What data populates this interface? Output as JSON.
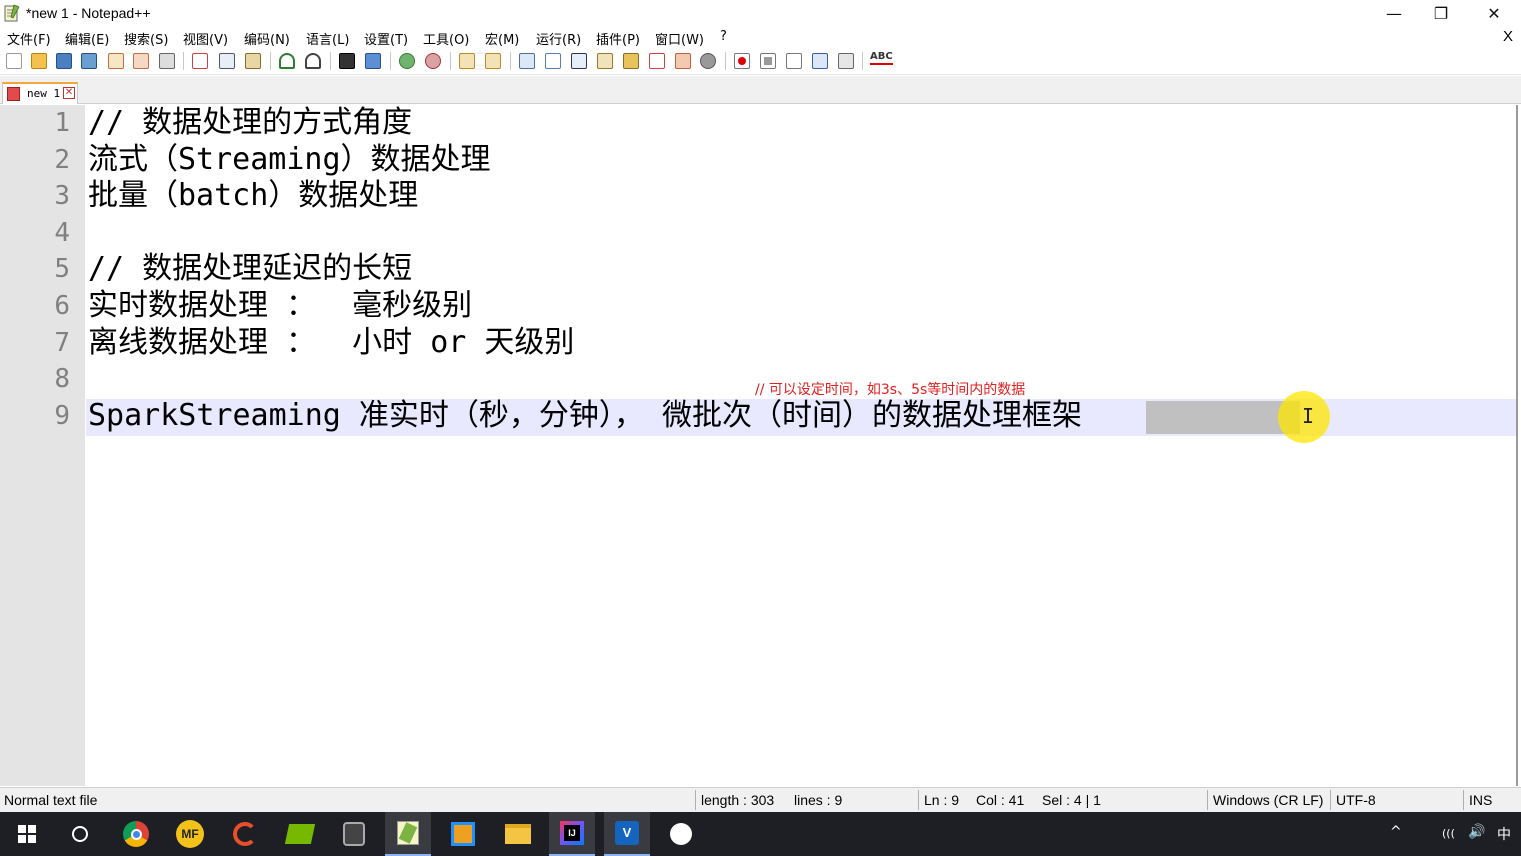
{
  "window": {
    "title": "*new 1 - Notepad++",
    "controls": {
      "minimize": "—",
      "maximize": "❐",
      "close": "✕"
    }
  },
  "menubar": {
    "items": [
      "文件(F)",
      "编辑(E)",
      "搜索(S)",
      "视图(V)",
      "编码(N)",
      "语言(L)",
      "设置(T)",
      "工具(O)",
      "宏(M)",
      "运行(R)",
      "插件(P)",
      "窗口(W)",
      "?"
    ],
    "close_doc": "X"
  },
  "toolbar": {
    "spellcheck_label": "ABC",
    "icons": [
      "new-file-icon",
      "open-file-icon",
      "save-icon",
      "save-all-icon",
      "close-icon",
      "close-all-icon",
      "print-icon",
      "cut-icon",
      "copy-icon",
      "paste-icon",
      "undo-icon",
      "redo-icon",
      "find-icon",
      "replace-icon",
      "zoom-in-icon",
      "zoom-out-icon",
      "sync-vertical-icon",
      "sync-horizontal-icon",
      "word-wrap-icon",
      "show-all-chars-icon",
      "indent-guide-icon",
      "doc-map-icon",
      "function-list-icon",
      "folder-workspace-icon",
      "monitoring-icon",
      "record-macro-icon",
      "stop-record-icon",
      "play-macro-icon",
      "run-macro-multiple-icon",
      "save-macro-icon",
      "spellcheck-icon"
    ]
  },
  "tabs": [
    {
      "label": "new 1",
      "active": true,
      "modified": true
    }
  ],
  "editor": {
    "lines": [
      {
        "num": "1",
        "text": "// 数据处理的方式角度"
      },
      {
        "num": "2",
        "text": "流式（Streaming）数据处理"
      },
      {
        "num": "3",
        "text": "批量（batch）数据处理"
      },
      {
        "num": "4",
        "text": ""
      },
      {
        "num": "5",
        "text": "// 数据处理延迟的长短"
      },
      {
        "num": "6",
        "text": "实时数据处理 ：  毫秒级别"
      },
      {
        "num": "7",
        "text": "离线数据处理 ：  小时 or 天级别"
      },
      {
        "num": "8",
        "text": ""
      },
      {
        "num": "9",
        "text": "SparkStreaming 准实时（秒，分钟）， 微批次（时间）的数据处理框架"
      }
    ],
    "current_line": 9,
    "selected_text": "处理框架",
    "annotation": "// 可以设定时间，如3s、5s等时间内的数据"
  },
  "statusbar": {
    "file_type": "Normal text file",
    "length": "length : 303",
    "lines": "lines : 9",
    "ln": "Ln : 9",
    "col": "Col : 41",
    "sel": "Sel : 4 | 1",
    "eol": "Windows (CR LF)",
    "encoding": "UTF-8",
    "mode": "INS"
  },
  "taskbar": {
    "apps": [
      "start-icon",
      "search-circle-icon",
      "chrome-icon",
      "mf-app-icon",
      "snail-app-icon",
      "nvidia-icon",
      "media-app-icon",
      "notepadpp-icon",
      "virtual-desktop-icon",
      "file-explorer-icon",
      "intellij-icon",
      "vm-app-icon",
      "smiley-app-icon"
    ],
    "mf_label": "MF",
    "tray": {
      "chevron": "^",
      "network": "(((",
      "volume": "🔊",
      "ime": "中"
    }
  },
  "colors": {
    "current_line": "#e8e8ff",
    "selection": "#c0c0c0",
    "annotation": "#e02020",
    "gutter": "#e4e4e4",
    "tab_accent": "#f3a63a",
    "taskbar": "#1e1f24"
  }
}
